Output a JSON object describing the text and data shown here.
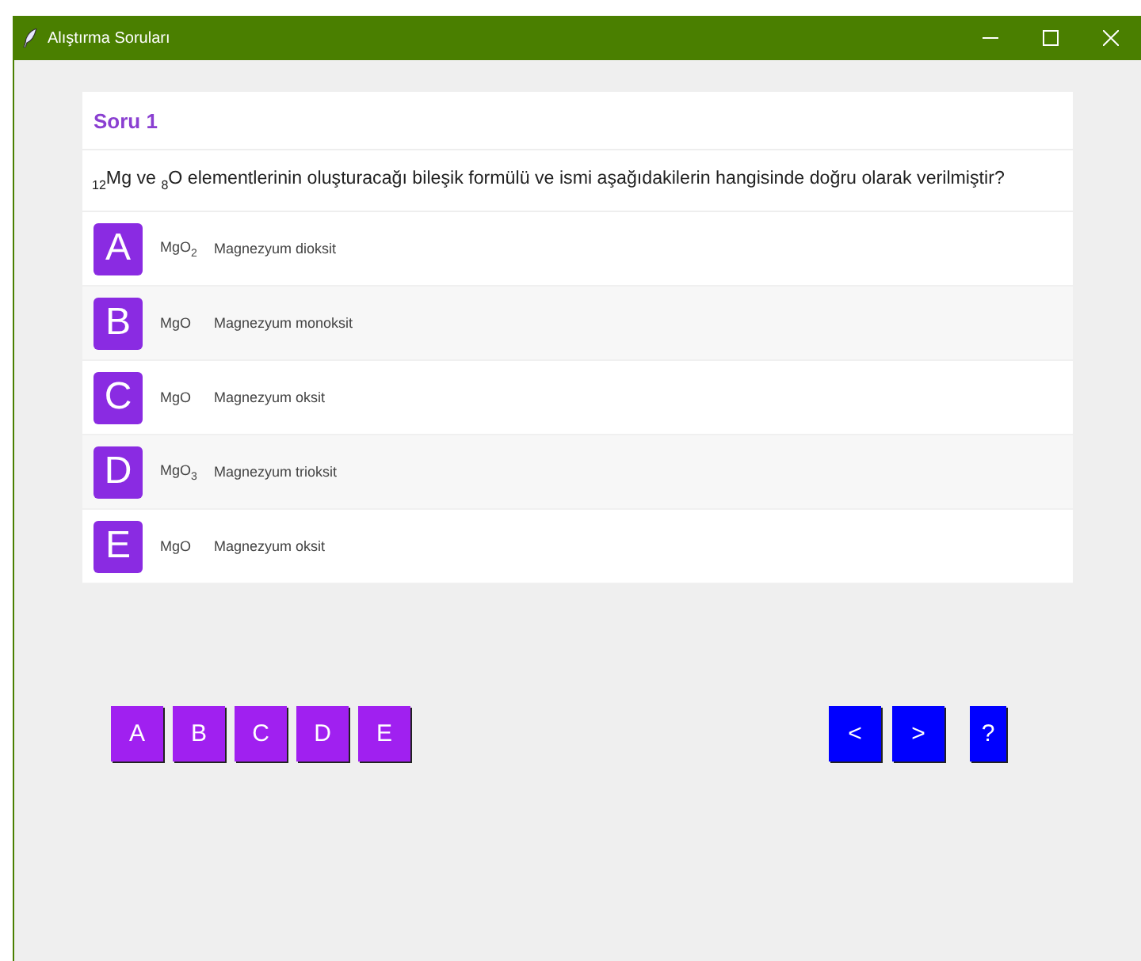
{
  "window": {
    "title": "Alıştırma Soruları"
  },
  "question": {
    "heading": "Soru 1",
    "text": "$_{12}$Mg ve $_{8}$O elementlerinin oluşturacağı bileşik formülü ve ismi aşağıdakilerin hangisinde doğru olarak verilmiştir?"
  },
  "options": [
    {
      "letter": "A",
      "formula": "MgO$_{2}$",
      "name": "Magnezyum dioksit"
    },
    {
      "letter": "B",
      "formula": "MgO",
      "name": "Magnezyum monoksit"
    },
    {
      "letter": "C",
      "formula": "MgO",
      "name": "Magnezyum oksit"
    },
    {
      "letter": "D",
      "formula": "MgO$_{3}$",
      "name": "Magnezyum trioksit"
    },
    {
      "letter": "E",
      "formula": "MgO",
      "name": "Magnezyum oksit"
    }
  ],
  "answer_buttons": [
    "A",
    "B",
    "C",
    "D",
    "E"
  ],
  "nav_buttons": [
    {
      "kind": "prev",
      "label": "<"
    },
    {
      "kind": "next",
      "label": ">"
    },
    {
      "kind": "help",
      "label": "?"
    }
  ]
}
